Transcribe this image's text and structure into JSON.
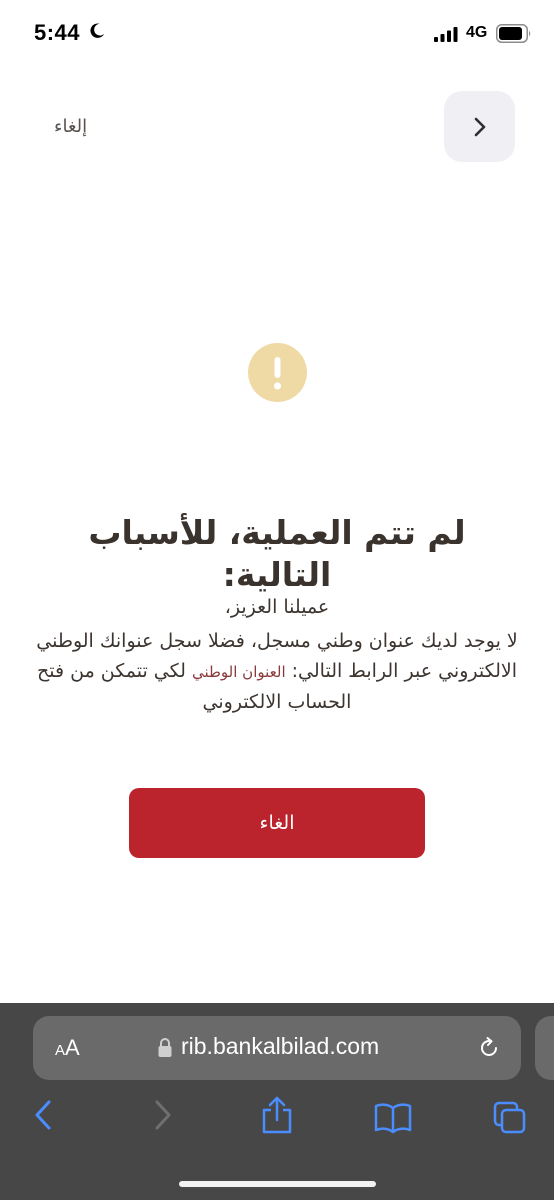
{
  "status_bar": {
    "time": "5:44",
    "network": "4G"
  },
  "header": {
    "cancel_label": "إلغاء"
  },
  "message": {
    "title": "لم تتم العملية، للأسباب التالية:",
    "greeting": "عميلنا العزيز،",
    "body_before_link": "لا يوجد لديك عنوان وطني مسجل، فضلا سجل عنوانك الوطني الالكتروني عبر الرابط التالي: ",
    "link_text": "العنوان الوطني",
    "body_after_link": " لكي تتمكن من فتح الحساب الالكتروني"
  },
  "primary_button": {
    "label": "الغاء"
  },
  "browser": {
    "aa_small": "A",
    "aa_large": "A",
    "url": "rib.bankalbilad.com"
  },
  "colors": {
    "accent": "#bb242c",
    "warning": "#efd9a4",
    "link": "#8a3a3a",
    "toolbar_icon": "#4a8dff"
  }
}
